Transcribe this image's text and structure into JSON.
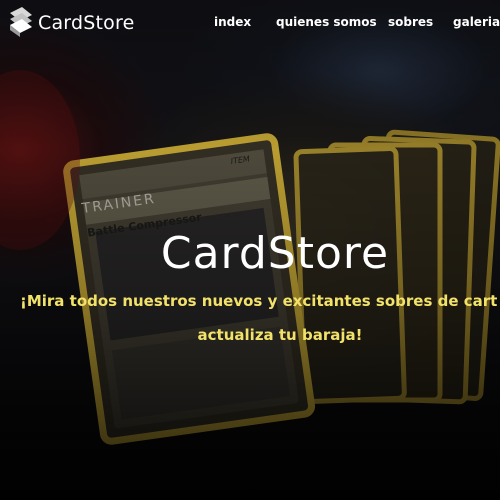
{
  "brand": {
    "name": "CardStore",
    "logo_icon": "stacked-cards-icon"
  },
  "nav": {
    "items": [
      {
        "label": "index"
      },
      {
        "label": "quienes somos"
      },
      {
        "label": "sobres"
      },
      {
        "label": "galeria"
      }
    ]
  },
  "hero": {
    "title": "CardStore",
    "subtitle_line1": "¡Mira todos nuestros nuevos y excitantes sobres de cart",
    "subtitle_line2": "actualiza tu baraja!",
    "card_label": "TRAINER",
    "card_name": "Battle Compressor",
    "card_subtext": "Team Flare Gear",
    "card_tag": "ITEM"
  },
  "colors": {
    "accent_text": "#f3e26a",
    "nav_text": "#ffffff",
    "card_border": "#d9b83a",
    "background": "#0b0b10"
  }
}
